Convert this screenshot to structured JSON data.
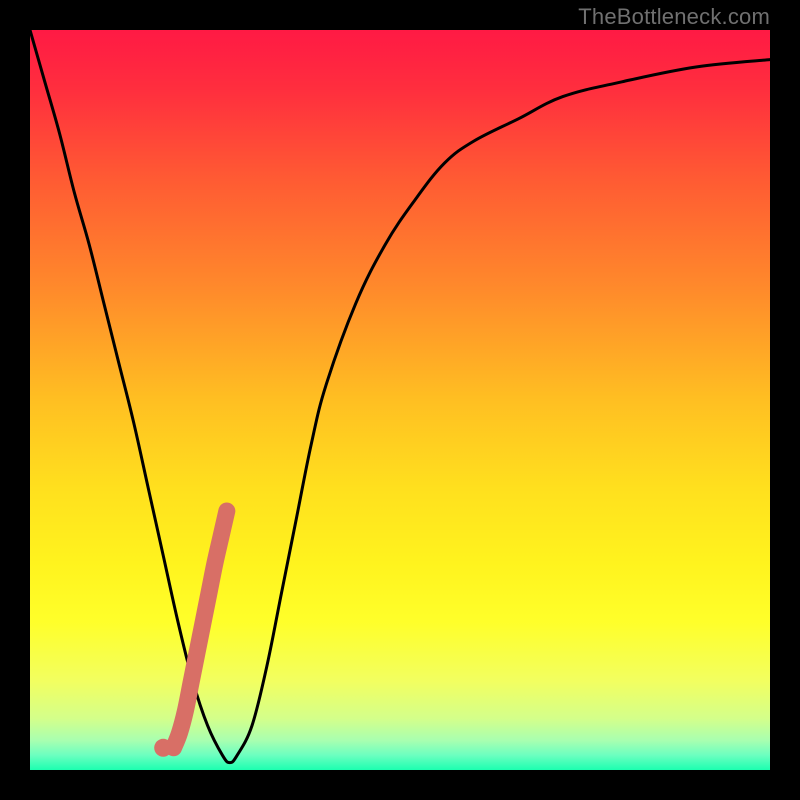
{
  "watermark": "TheBottleneck.com",
  "chart_data": {
    "type": "line",
    "title": "",
    "xlabel": "",
    "ylabel": "",
    "xlim": [
      0,
      100
    ],
    "ylim": [
      0,
      100
    ],
    "gradient_stops": [
      {
        "pos": 0.0,
        "color": "#ff1a44"
      },
      {
        "pos": 0.08,
        "color": "#ff2e3e"
      },
      {
        "pos": 0.2,
        "color": "#ff5a33"
      },
      {
        "pos": 0.35,
        "color": "#ff8a2b"
      },
      {
        "pos": 0.5,
        "color": "#ffbf22"
      },
      {
        "pos": 0.62,
        "color": "#ffe01e"
      },
      {
        "pos": 0.72,
        "color": "#fff31e"
      },
      {
        "pos": 0.8,
        "color": "#ffff2a"
      },
      {
        "pos": 0.88,
        "color": "#f2ff60"
      },
      {
        "pos": 0.93,
        "color": "#d4ff8a"
      },
      {
        "pos": 0.96,
        "color": "#a8ffb0"
      },
      {
        "pos": 0.98,
        "color": "#6cffc0"
      },
      {
        "pos": 1.0,
        "color": "#1cffb0"
      }
    ],
    "series": [
      {
        "name": "bottleneck-curve",
        "x": [
          0,
          2,
          4,
          6,
          8,
          10,
          12,
          14,
          16,
          18,
          20,
          22,
          24,
          26,
          27,
          28,
          30,
          32,
          34,
          36,
          38,
          40,
          44,
          48,
          52,
          56,
          60,
          66,
          72,
          80,
          90,
          100
        ],
        "y": [
          100,
          93,
          86,
          78,
          71,
          63,
          55,
          47,
          38,
          29,
          20,
          12,
          6,
          2,
          1,
          2,
          6,
          14,
          24,
          34,
          44,
          52,
          63,
          71,
          77,
          82,
          85,
          88,
          91,
          93,
          95,
          96
        ]
      }
    ],
    "highlight_segment": {
      "name": "salmon-highlight",
      "color": "#d86f66",
      "points": [
        {
          "x": 18.0,
          "y": 3.0
        },
        {
          "x": 18.6,
          "y": 2.0
        },
        {
          "x": 19.4,
          "y": 3.0
        },
        {
          "x": 20.2,
          "y": 5.0
        },
        {
          "x": 21.0,
          "y": 8.0
        },
        {
          "x": 21.8,
          "y": 12.0
        },
        {
          "x": 22.6,
          "y": 16.0
        },
        {
          "x": 23.4,
          "y": 20.0
        },
        {
          "x": 24.2,
          "y": 24.0
        },
        {
          "x": 25.0,
          "y": 28.0
        },
        {
          "x": 25.8,
          "y": 31.5
        },
        {
          "x": 26.6,
          "y": 35.0
        }
      ]
    }
  }
}
